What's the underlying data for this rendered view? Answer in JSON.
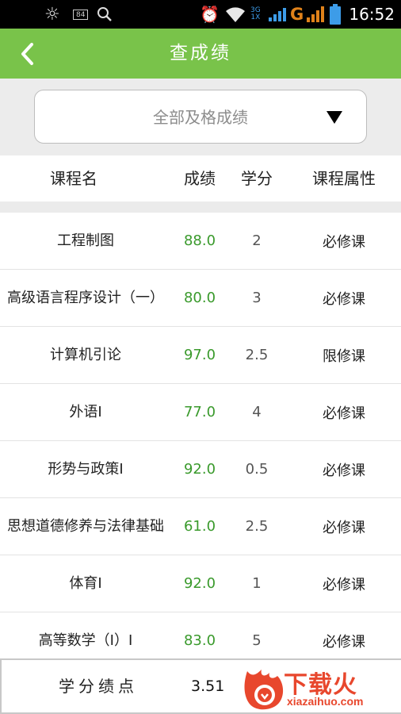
{
  "status_bar": {
    "time": "16:52",
    "box_indicator": "84",
    "network_3g": "3G",
    "network_sub": "1X",
    "carrier_g": "G",
    "icons": [
      "brightness-icon",
      "notification-box-icon",
      "search-icon",
      "alarm-icon",
      "wifi-icon",
      "signal-3g-icon",
      "signal-bars-icon",
      "battery-icon"
    ]
  },
  "header": {
    "title": "查成绩",
    "back_icon": "chevron-left-icon"
  },
  "filter": {
    "selected": "全部及格成绩",
    "dropdown_icon": "triangle-down-icon"
  },
  "table": {
    "columns": [
      "课程名",
      "成绩",
      "学分",
      "课程属性"
    ],
    "rows": [
      {
        "name": "工程制图",
        "score": "88.0",
        "credit": "2",
        "type": "必修课"
      },
      {
        "name": "高级语言程序设计（一）",
        "score": "80.0",
        "credit": "3",
        "type": "必修课"
      },
      {
        "name": "计算机引论",
        "score": "97.0",
        "credit": "2.5",
        "type": "限修课"
      },
      {
        "name": "外语Ⅰ",
        "score": "77.0",
        "credit": "4",
        "type": "必修课"
      },
      {
        "name": "形势与政策Ⅰ",
        "score": "92.0",
        "credit": "0.5",
        "type": "必修课"
      },
      {
        "name": "思想道德修养与法律基础",
        "score": "61.0",
        "credit": "2.5",
        "type": "必修课"
      },
      {
        "name": "体育Ⅰ",
        "score": "92.0",
        "credit": "1",
        "type": "必修课"
      },
      {
        "name": "高等数学（Ⅰ）Ⅰ",
        "score": "83.0",
        "credit": "5",
        "type": "必修课"
      }
    ]
  },
  "gpa": {
    "label": "学分绩点",
    "value": "3.51"
  },
  "watermark": {
    "text": "下载火",
    "url_text": "xiazaihuo.com"
  },
  "colors": {
    "title_bar": "#79c34a",
    "score_green": "#3a9a2c",
    "watermark_red": "#e8472d"
  }
}
